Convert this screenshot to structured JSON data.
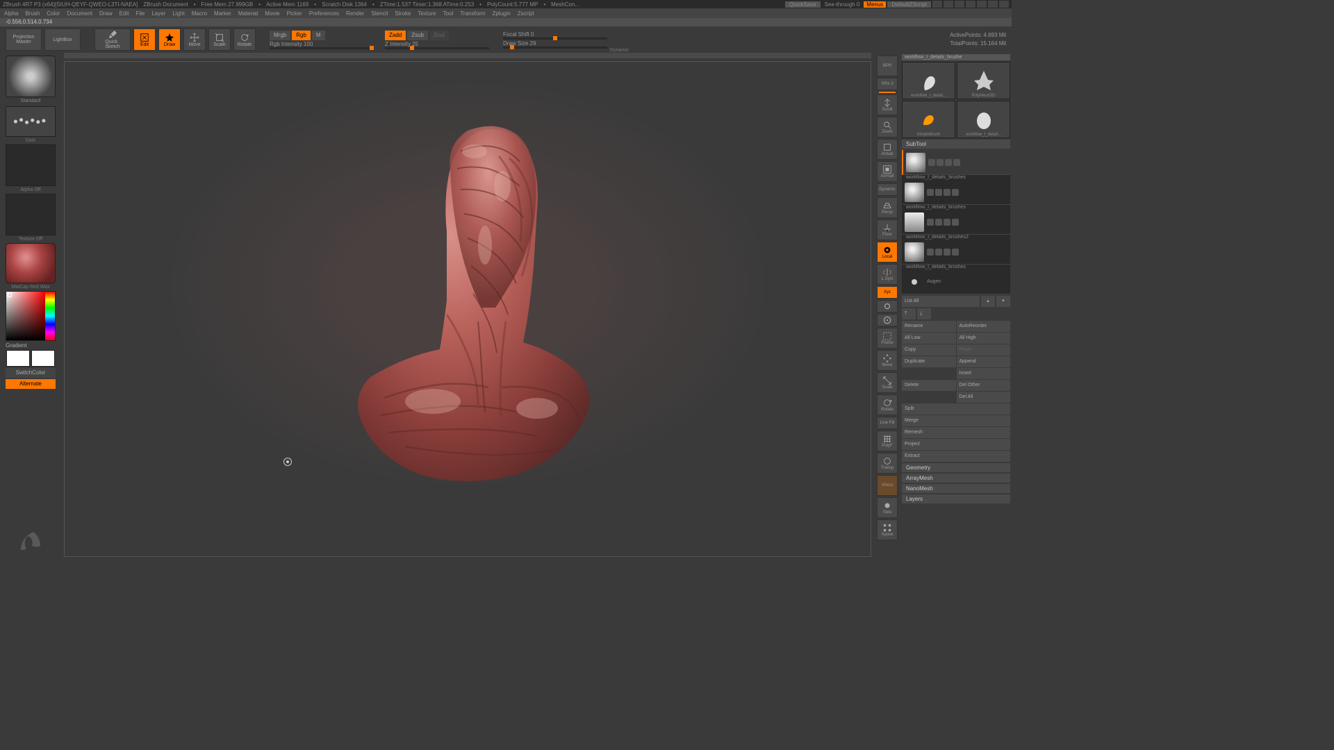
{
  "title": {
    "app": "ZBrush 4R7 P3 (x64)[SIUH-QEYF-QWEO-L3TI-NAEA]",
    "doc": "ZBrush Document",
    "mem": "Free Mem 27.999GB",
    "amem": "Active Mem 1169",
    "scratch": "Scratch Disk 1364",
    "ztime": "ZTime:1.537 Timer:1.368 ATime:0.253",
    "poly": "PolyCount:5.777 MP",
    "mesh": "MeshCon...",
    "quicksave": "QuickSave",
    "seethrough": "See-through  0",
    "menus": "Menus",
    "script": "DefaultZScript"
  },
  "menubar": [
    "Alpha",
    "Brush",
    "Color",
    "Document",
    "Draw",
    "Edit",
    "File",
    "Layer",
    "Light",
    "Macro",
    "Marker",
    "Material",
    "Movie",
    "Picker",
    "Preferences",
    "Render",
    "Stencil",
    "Stroke",
    "Texture",
    "Tool",
    "Transform",
    "Zplugin",
    "Zscript"
  ],
  "coords": "-0.556,0.514,0.734",
  "toolbar": {
    "projection": "Projection\nMaster",
    "lightbox": "LightBox",
    "quicksketch": "Quick\nSketch",
    "edit": "Edit",
    "draw": "Draw",
    "move": "Move",
    "scale": "Scale",
    "rotate": "Rotate",
    "mrgb": "Mrgb",
    "rgb": "Rgb",
    "m": "M",
    "rgbIntensity": "Rgb Intensity 100",
    "zadd": "Zadd",
    "zsub": "Zsub",
    "zcut": "Zcut",
    "zIntensity": "Z Intensity 25",
    "focalShift": "Focal Shift 0",
    "drawSize": "Draw Size 29",
    "dynamic": "Dynamic",
    "activePoints": "ActivePoints: 4.693 Mil",
    "totalPoints": "TotalPoints: 15.164 Mil"
  },
  "left": {
    "brush": "Standard",
    "stroke": "Dots",
    "alpha": "Alpha Off",
    "texture": "Texture Off",
    "material": "MatCap Red Wax",
    "gradient": "Gradient",
    "switchcolor": "SwitchColor",
    "alternate": "Alternate"
  },
  "rightToolbar": {
    "bpr": "BPR",
    "spix": "SPix 3",
    "scroll": "Scroll",
    "zoom": "Zoom",
    "actual": "Actual",
    "aahalf": "AAHalf",
    "dynamic": "Dynamic",
    "persp": "Persp",
    "floor": "Floor",
    "local": "Local",
    "lsym": "L.Sym",
    "xyz": "Xyz",
    "frame": "Frame",
    "move": "Move",
    "scale": "Scale",
    "rotate": "Rotate",
    "linefill": "Line Fill",
    "polyf": "PolyF",
    "transp": "Transp",
    "ghost": "Ghost",
    "solo": "Solo",
    "xpose": "Xpose"
  },
  "tool": {
    "filename": "workflow_I_details_brushe",
    "cells": [
      "workflow_I_detail...",
      "PolyMesh3D",
      "SimpleBrush",
      "workflow_I_detail..."
    ]
  },
  "subtool": {
    "header": "SubTool",
    "items": [
      {
        "name": "workflow_I_details_brushes",
        "thumb": "bust"
      },
      {
        "name": "workflow_I_details_brushes",
        "thumb": "bust"
      },
      {
        "name": "workflow_I_details_brushes2",
        "thumb": "figure"
      },
      {
        "name": "workflow_I_details_brushes",
        "thumb": "bust"
      },
      {
        "name": "Augen",
        "thumb": "sphere"
      }
    ],
    "listAll": "List All",
    "buttons": {
      "rename": "Rename",
      "autoreorder": "AutoReorder",
      "alllow": "All Low",
      "allhigh": "All High",
      "copy": "Copy",
      "paste": "Paste",
      "duplicate": "Duplicate",
      "append": "Append",
      "insert": "Insert",
      "delete": "Delete",
      "delother": "Del Other",
      "delall": "Del All",
      "split": "Split",
      "merge": "Merge",
      "remesh": "Remesh",
      "project": "Project",
      "extract": "Extract"
    },
    "sections": [
      "Geometry",
      "ArrayMesh",
      "NanoMesh",
      "Layers"
    ]
  }
}
